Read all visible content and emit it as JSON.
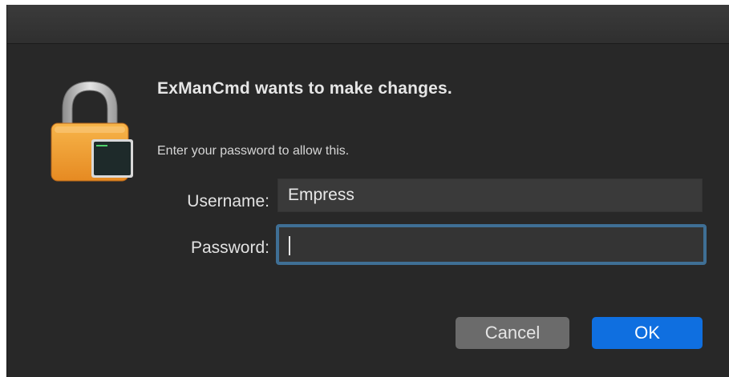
{
  "dialog": {
    "title": "ExManCmd wants to make changes.",
    "subtitle": "Enter your password to allow this.",
    "username_label": "Username:",
    "username_value": "Empress",
    "password_label": "Password:",
    "password_value": "",
    "cancel_label": "Cancel",
    "ok_label": "OK",
    "icon": "lock-terminal-icon"
  },
  "colors": {
    "background": "#282828",
    "accent": "#0f6fe0",
    "focus_ring": "#3f6f95",
    "lock_body": "#f3a43a"
  }
}
